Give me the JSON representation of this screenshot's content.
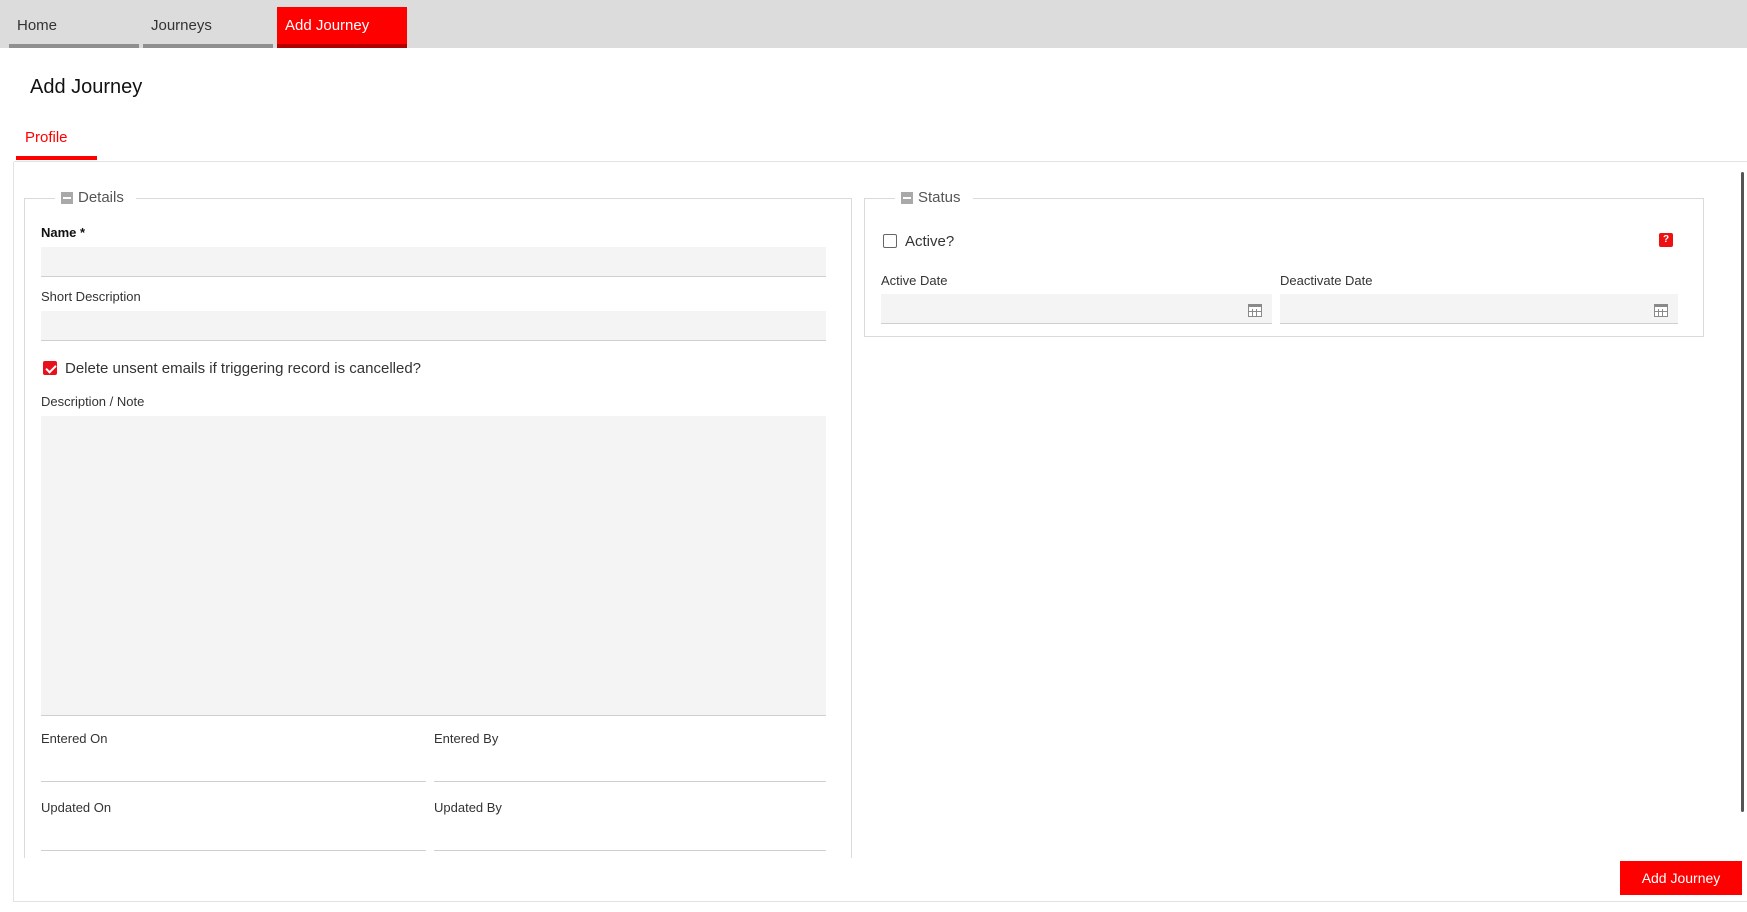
{
  "top_tabs": [
    {
      "label": "Home"
    },
    {
      "label": "Journeys"
    },
    {
      "label": "Add Journey"
    }
  ],
  "page_title": "Add Journey",
  "sub_tabs": [
    {
      "label": "Profile"
    }
  ],
  "details": {
    "legend": "Details",
    "name_label": "Name *",
    "name_value": "",
    "short_description_label": "Short Description",
    "short_description_value": "",
    "delete_unsent_label": "Delete unsent emails if triggering record is cancelled?",
    "delete_unsent_checked": true,
    "description_label": "Description / Note",
    "description_value": "",
    "entered_on_label": "Entered On",
    "entered_by_label": "Entered By",
    "updated_on_label": "Updated On",
    "updated_by_label": "Updated By"
  },
  "status": {
    "legend": "Status",
    "active_label": "Active?",
    "active_checked": false,
    "help_icon_text": "?",
    "active_date_label": "Active Date",
    "active_date_value": "",
    "deactivate_date_label": "Deactivate Date",
    "deactivate_date_value": ""
  },
  "actions": {
    "add_journey_label": "Add Journey"
  },
  "icons": {
    "collapse": "minus-square-icon",
    "calendar": "calendar-icon",
    "help": "question-mark-icon"
  },
  "colors": {
    "accent": "#ff0000",
    "tabbar": "#dcdcdc",
    "field_bg": "#f4f4f4"
  }
}
